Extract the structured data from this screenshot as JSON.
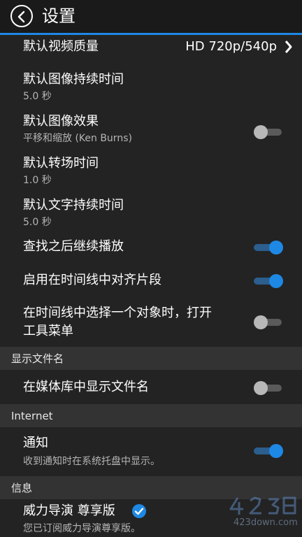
{
  "header": {
    "title": "设置"
  },
  "items": {
    "video_quality": {
      "label": "默认视频质量",
      "value": "HD 720p/540p"
    },
    "image_duration": {
      "label": "默认图像持续时间",
      "value": "5.0 秒"
    },
    "image_effect": {
      "label": "默认图像效果",
      "value": "平移和缩放 (Ken Burns)",
      "toggle": false
    },
    "transition_time": {
      "label": "默认转场时间",
      "value": "1.0 秒"
    },
    "text_duration": {
      "label": "默认文字持续时间",
      "value": "5.0 秒"
    },
    "continue_play": {
      "label": "查找之后继续播放",
      "toggle": true
    },
    "snap_clips": {
      "label": "启用在时间线中对齐片段",
      "toggle": true
    },
    "open_toolmenu": {
      "label_line1": "在时间线中选择一个对象时，打开",
      "label_line2": "工具菜单",
      "toggle": false
    }
  },
  "sections": {
    "filename": {
      "title": "显示文件名",
      "show_in_library": {
        "label": "在媒体库中显示文件名",
        "toggle": false
      }
    },
    "internet": {
      "title": "Internet",
      "notifications": {
        "label": "通知",
        "value": "收到通知时在系统托盘中显示。",
        "toggle": true
      }
    },
    "info": {
      "title": "信息",
      "premium": {
        "label": "威力导演 尊享版",
        "value": "您已订阅威力导演尊享版。"
      }
    }
  },
  "watermark": {
    "text": "423down.com"
  },
  "colors": {
    "accent": "#1e88e5",
    "background": "#232323",
    "section_bg": "#333333",
    "subtext": "#b5b5b5"
  },
  "icons": {
    "back": "back-arrow-circle-icon",
    "chevron": "chevron-right-icon",
    "verified": "check-circle-icon"
  }
}
